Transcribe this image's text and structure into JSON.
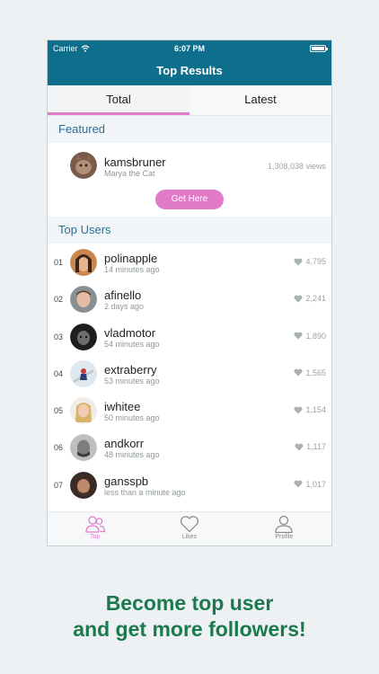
{
  "status": {
    "carrier": "Carrier",
    "time": "6:07 PM"
  },
  "nav": {
    "title": "Top Results"
  },
  "tabs": [
    {
      "label": "Total",
      "active": true
    },
    {
      "label": "Latest",
      "active": false
    }
  ],
  "featured": {
    "header": "Featured",
    "username": "kamsbruner",
    "subtitle": "Marya the Cat",
    "views": "1,308,038 views",
    "button": "Get Here"
  },
  "top_users": {
    "header": "Top Users",
    "items": [
      {
        "rank": "01",
        "username": "polinapple",
        "ago": "14 minutes ago",
        "likes": "4,795"
      },
      {
        "rank": "02",
        "username": "afinello",
        "ago": "2 days ago",
        "likes": "2,241"
      },
      {
        "rank": "03",
        "username": "vladmotor",
        "ago": "54 minutes ago",
        "likes": "1,890"
      },
      {
        "rank": "04",
        "username": "extraberry",
        "ago": "53 minutes ago",
        "likes": "1,565"
      },
      {
        "rank": "05",
        "username": "iwhitee",
        "ago": "50 minutes ago",
        "likes": "1,154"
      },
      {
        "rank": "06",
        "username": "andkorr",
        "ago": "48 minutes ago",
        "likes": "1,117"
      },
      {
        "rank": "07",
        "username": "gansspb",
        "ago": "less than a minute ago",
        "likes": "1,017"
      }
    ]
  },
  "tabbar": [
    {
      "label": "Top",
      "icon": "users-icon",
      "active": true
    },
    {
      "label": "Likes",
      "icon": "heart-icon",
      "active": false
    },
    {
      "label": "Profile",
      "icon": "person-icon",
      "active": false
    }
  ],
  "promo": {
    "line1": "Become top user",
    "line2": "and get more followers!"
  },
  "colors": {
    "nav": "#0e6f8c",
    "accent": "#e07ac9",
    "section_text": "#2a6f93",
    "promo": "#1a7a4d"
  }
}
